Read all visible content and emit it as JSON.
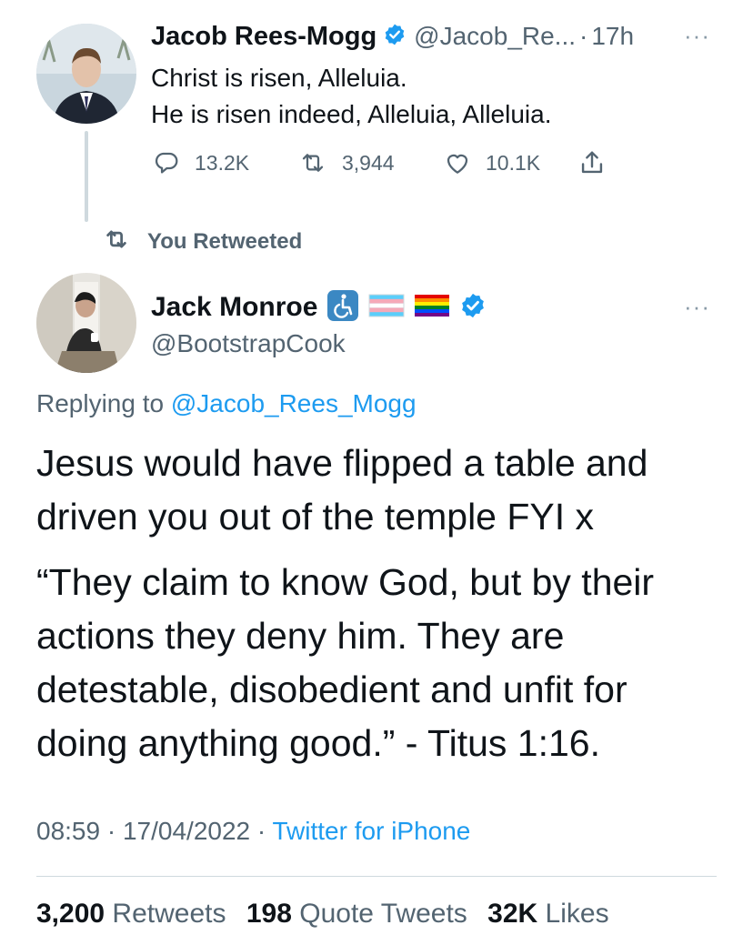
{
  "parent_tweet": {
    "author_name": "Jacob Rees-Mogg",
    "handle": "@Jacob_Re...",
    "separator": "·",
    "time": "17h",
    "more": "···",
    "text_lines": [
      "Christ is risen, Alleluia.",
      "He is risen indeed, Alleluia, Alleluia."
    ],
    "actions": {
      "replies": "13.2K",
      "retweets": "3,944",
      "likes": "10.1K"
    },
    "icons": [
      "verified-badge-icon",
      "reply-icon",
      "retweet-icon",
      "like-icon",
      "share-icon"
    ]
  },
  "retweet_indicator": {
    "label": "You Retweeted",
    "icon": "retweet-icon"
  },
  "main_tweet": {
    "author_name": "Jack Monroe",
    "handle": "@BootstrapCook",
    "more": "···",
    "emoji": [
      "wheelchair-emoji",
      "transgender-flag-emoji",
      "rainbow-flag-emoji"
    ],
    "replying_prefix": "Replying to",
    "replying_to": "@Jacob_Rees_Mogg",
    "paragraph_1": "Jesus would have flipped a table and driven you out of the temple FYI x",
    "paragraph_2": "“They claim to know God, but by their actions they deny him. They are detestable, disobedient and unfit for doing anything good.” - Titus 1:16.",
    "time": "08:59",
    "date": "17/04/2022",
    "meta_separator": "·",
    "source": "Twitter for iPhone",
    "stats": {
      "retweets_count": "3,200",
      "retweets_label": "Retweets",
      "quotes_count": "198",
      "quotes_label": "Quote Tweets",
      "likes_count": "32K",
      "likes_label": "Likes"
    }
  },
  "colors": {
    "text_primary": "#0f1419",
    "text_secondary": "#536471",
    "link": "#1d9bf0",
    "divider": "#cfd9de"
  }
}
